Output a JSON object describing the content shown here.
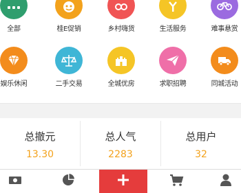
{
  "colors": {
    "accent": "#f3a21c",
    "active_tab": "#e53c3c",
    "gray_icon": "#555555"
  },
  "grid": {
    "row1": [
      {
        "label": "全部",
        "icon": "apps-icon",
        "color": "#2f9e6e"
      },
      {
        "label": "桂E促销",
        "icon": "smiley-icon",
        "color": "#f3a21c"
      },
      {
        "label": "乡村嗨货",
        "icon": "basket-icon",
        "color": "#f05454"
      },
      {
        "label": "生活服务",
        "icon": "service-icon",
        "color": "#f5c526"
      },
      {
        "label": "难事悬赏",
        "icon": "bike-icon",
        "color": "#9b6be0"
      }
    ],
    "row2": [
      {
        "label": "娱乐休闲",
        "icon": "diamond-icon",
        "color": "#f38c1c"
      },
      {
        "label": "二手交易",
        "icon": "scale-icon",
        "color": "#3fb6d6"
      },
      {
        "label": "全城优房",
        "icon": "castle-icon",
        "color": "#f5c526"
      },
      {
        "label": "求职招聘",
        "icon": "paper-plane-icon",
        "color": "#ef6fa8"
      },
      {
        "label": "同城活动",
        "icon": "truck-icon",
        "color": "#f38c1c"
      }
    ]
  },
  "stats": [
    {
      "title": "总撤元",
      "value": "13.30"
    },
    {
      "title": "总人气",
      "value": "2283"
    },
    {
      "title": "总用户",
      "value": "32"
    }
  ],
  "tabbar": [
    {
      "name": "money-icon"
    },
    {
      "name": "pie-chart-icon"
    },
    {
      "name": "plus-icon"
    },
    {
      "name": "cart-icon"
    },
    {
      "name": "user-icon"
    }
  ]
}
